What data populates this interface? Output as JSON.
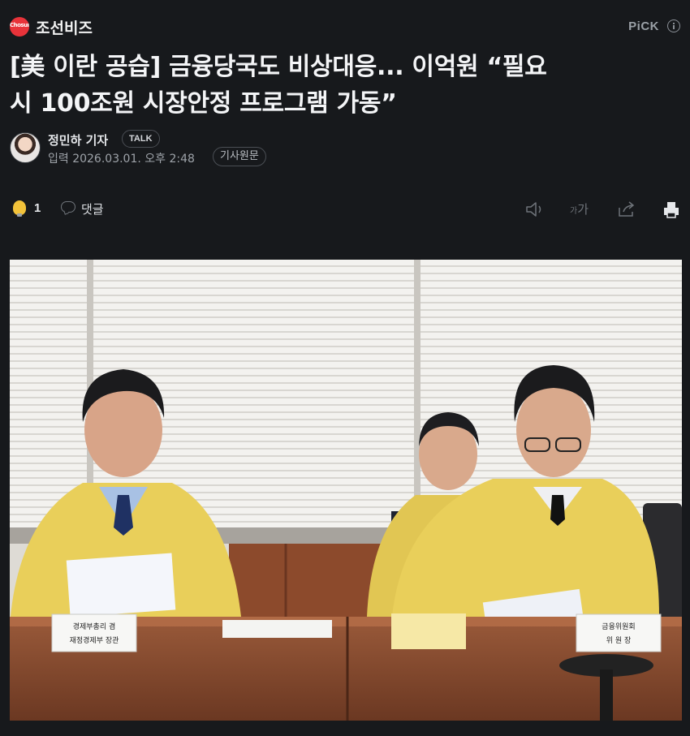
{
  "header": {
    "press_name": "조선비즈",
    "press_logo_text": "ChosunBiz",
    "pick_label": "PiCK",
    "info_icon": "info-icon"
  },
  "article": {
    "headline_line1": "[美 이란 공습] 금융당국도 비상대응... 이억원 “필요",
    "headline_line2": "시 100조원 시장안정 프로그램 가동”",
    "reporter": "정민하 기자",
    "talk_label": "TALK",
    "date": "입력 2026.03.01. 오후 2:48",
    "original_link": "기사원문"
  },
  "actions": {
    "reaction_icon": "lightbulb-icon",
    "reaction_count": "1",
    "comment_label": "댓글",
    "fontsize_label_small": "가",
    "fontsize_label": "가",
    "icons": [
      "speaker-icon",
      "font-size-icon",
      "share-icon",
      "print-icon"
    ]
  },
  "photo": {
    "nameplate_left_line1": "경제부총리 겸",
    "nameplate_left_line2": "재정경제부 장관",
    "nameplate_right_line1": "금융위원회",
    "nameplate_right_line2": "위 원 장"
  },
  "colors": {
    "background": "#17191c",
    "brand_red": "#e8333a",
    "reaction_yellow": "#f2c23a",
    "jacket_yellow": "#e9cf5a"
  }
}
